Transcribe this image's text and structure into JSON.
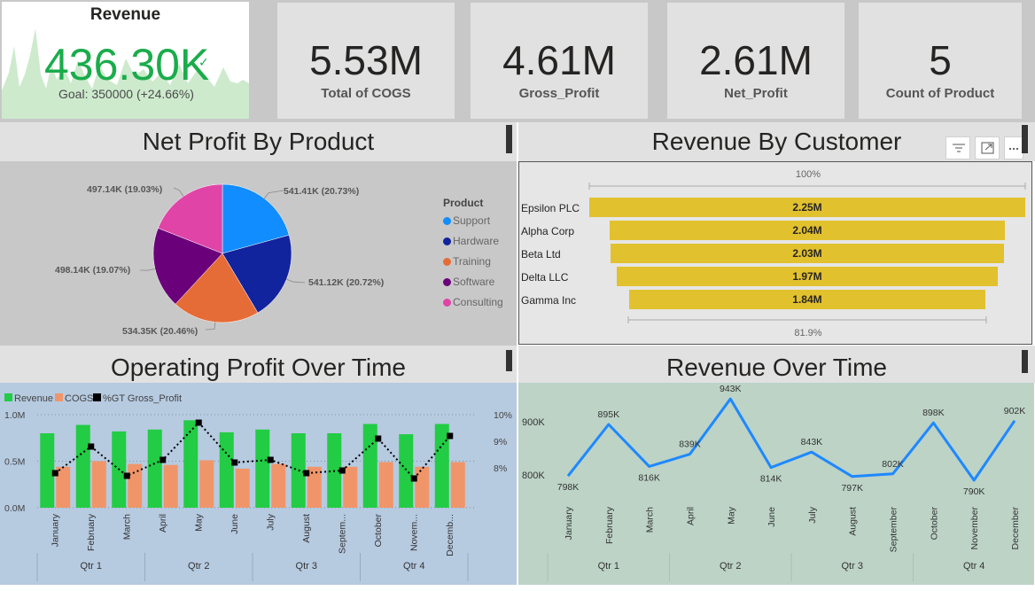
{
  "colors": {
    "green": "#1aac4b",
    "blue": "#118dff",
    "navy": "#12239e",
    "orange": "#e66c37",
    "purple": "#6b007b",
    "pink": "#e044a7",
    "gold": "#e2c12e",
    "bar_green": "#22cc44",
    "bar_salmon": "#f0956a",
    "line_blue": "#1e88ff"
  },
  "kpis": {
    "revenue": {
      "title": "Revenue",
      "value": "436.30K",
      "check_icon": "✓",
      "goal": "Goal: 350000 (+24.66%)"
    },
    "cards": [
      {
        "value": "5.53M",
        "label": "Total of COGS"
      },
      {
        "value": "4.61M",
        "label": "Gross_Profit"
      },
      {
        "value": "2.61M",
        "label": "Net_Profit"
      },
      {
        "value": "5",
        "label": "Count of Product"
      }
    ]
  },
  "panels": {
    "pie_title": "Net Profit By Product",
    "funnel_title": "Revenue  By Customer",
    "combo_title": "Operating Profit Over Time",
    "line_title": "Revenue Over Time"
  },
  "icons": {
    "filter": "filter-icon",
    "focus": "focus-mode-icon",
    "more": "more-options-icon"
  },
  "chart_data": [
    {
      "id": "net-profit-by-product",
      "type": "pie",
      "legend_title": "Product",
      "legend_position": "right",
      "slices": [
        {
          "name": "Support",
          "value": 541.41,
          "label": "541.41K (20.73%)",
          "color": "#118dff"
        },
        {
          "name": "Hardware",
          "value": 541.12,
          "label": "541.12K (20.72%)",
          "color": "#12239e"
        },
        {
          "name": "Training",
          "value": 534.35,
          "label": "534.35K (20.46%)",
          "color": "#e66c37"
        },
        {
          "name": "Software",
          "value": 498.14,
          "label": "498.14K (19.07%)",
          "color": "#6b007b"
        },
        {
          "name": "Consulting",
          "value": 497.14,
          "label": "497.14K (19.03%)",
          "color": "#e044a7"
        }
      ]
    },
    {
      "id": "revenue-by-customer",
      "type": "funnel",
      "top_label": "100%",
      "bottom_label": "81.9%",
      "categories": [
        "Epsilon PLC",
        "Alpha Corp",
        "Beta Ltd",
        "Delta LLC",
        "Gamma Inc"
      ],
      "values": [
        2.25,
        2.04,
        2.03,
        1.97,
        1.84
      ],
      "labels": [
        "2.25M",
        "2.04M",
        "2.03M",
        "1.97M",
        "1.84M"
      ]
    },
    {
      "id": "operating-profit-over-time",
      "type": "bar",
      "legend": [
        "Revenue",
        "COGS",
        "%GT Gross_Profit"
      ],
      "legend_position": "top-left",
      "categories": [
        "January",
        "February",
        "March",
        "April",
        "May",
        "June",
        "July",
        "August",
        "Septem...",
        "October",
        "Novem...",
        "Decemb..."
      ],
      "quarters": [
        "Qtr 1",
        "Qtr 2",
        "Qtr 3",
        "Qtr 4"
      ],
      "series": [
        {
          "name": "Revenue",
          "values": [
            0.8,
            0.89,
            0.82,
            0.84,
            0.94,
            0.81,
            0.84,
            0.8,
            0.8,
            0.9,
            0.79,
            0.9
          ]
        },
        {
          "name": "COGS",
          "values": [
            0.44,
            0.5,
            0.47,
            0.46,
            0.51,
            0.42,
            0.47,
            0.44,
            0.44,
            0.49,
            0.44,
            0.49
          ]
        },
        {
          "name": "%GT Gross_Profit",
          "values": [
            7.8,
            8.8,
            7.7,
            8.3,
            9.7,
            8.2,
            8.3,
            7.8,
            7.9,
            9.1,
            7.6,
            9.2
          ]
        }
      ],
      "y_left_ticks": [
        "1.0M",
        "0.5M",
        "0.0M"
      ],
      "y_right_ticks": [
        "10%",
        "9%",
        "8%"
      ],
      "ylim_left": [
        0,
        1.0
      ],
      "ylim_right": [
        6.5,
        10.0
      ]
    },
    {
      "id": "revenue-over-time",
      "type": "line",
      "categories": [
        "January",
        "February",
        "March",
        "April",
        "May",
        "June",
        "July",
        "August",
        "September",
        "October",
        "November",
        "December"
      ],
      "quarters": [
        "Qtr 1",
        "Qtr 2",
        "Qtr 3",
        "Qtr 4"
      ],
      "values": [
        798,
        895,
        816,
        839,
        943,
        814,
        843,
        797,
        802,
        898,
        790,
        902
      ],
      "labels": [
        "798K",
        "895K",
        "816K",
        "839K",
        "943K",
        "814K",
        "843K",
        "797K",
        "802K",
        "898K",
        "790K",
        "902K"
      ],
      "y_ticks": [
        "900K",
        "800K"
      ],
      "ylim": [
        770,
        950
      ]
    }
  ]
}
